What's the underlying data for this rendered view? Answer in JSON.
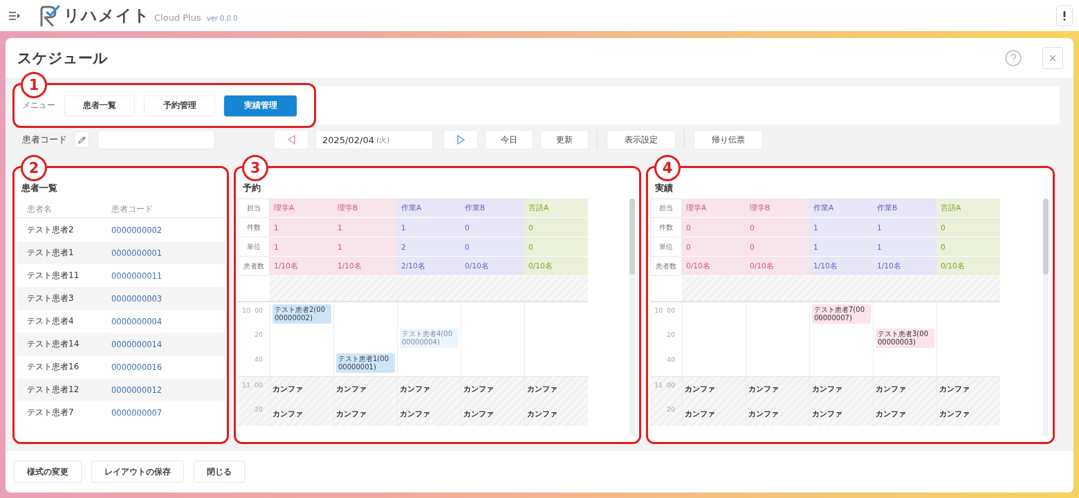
{
  "app_bar": {
    "product": "リハメイト",
    "edition": "Cloud Plus",
    "version": "ver 0.0.0"
  },
  "dialog": {
    "title": "スケジュール"
  },
  "menu": {
    "annotation": "1",
    "label": "メニュー",
    "items": [
      {
        "label": "患者一覧",
        "selected": false
      },
      {
        "label": "予約管理",
        "selected": false
      },
      {
        "label": "実績管理",
        "selected": true
      }
    ]
  },
  "toolbar": {
    "patient_code_label": "患者コード",
    "date": {
      "value": "2025/02/04",
      "weekday": "(火)"
    },
    "button_groups": [
      [
        "今日",
        "更新"
      ],
      [
        "表示設定"
      ],
      [
        "帰り伝票"
      ]
    ]
  },
  "patients": {
    "annotation": "2",
    "title": "患者一覧",
    "columns": [
      "患者名",
      "患者コード"
    ],
    "rows": [
      {
        "name": "テスト患者2",
        "code": "0000000002"
      },
      {
        "name": "テスト患者1",
        "code": "0000000001"
      },
      {
        "name": "テスト患者11",
        "code": "0000000011"
      },
      {
        "name": "テスト患者3",
        "code": "0000000003"
      },
      {
        "name": "テスト患者4",
        "code": "0000000004"
      },
      {
        "name": "テスト患者14",
        "code": "0000000014"
      },
      {
        "name": "テスト患者16",
        "code": "0000000016"
      },
      {
        "name": "テスト患者12",
        "code": "0000000012"
      },
      {
        "name": "テスト患者7",
        "code": "0000000007"
      }
    ]
  },
  "reservations": {
    "annotation": "3",
    "title": "予約",
    "staff_label": "担当",
    "staff": [
      {
        "name": "理学A",
        "color": "#d4557f"
      },
      {
        "name": "理学B",
        "color": "#d4557f"
      },
      {
        "name": "作業A",
        "color": "#6a62c4"
      },
      {
        "name": "作業B",
        "color": "#6a62c4"
      },
      {
        "name": "言語A",
        "color": "#7fa41c"
      }
    ],
    "summary_rows": [
      {
        "label": "件数",
        "values": [
          "1",
          "1",
          "1",
          "0",
          "0"
        ]
      },
      {
        "label": "単位",
        "values": [
          "1",
          "1",
          "2",
          "0",
          "0"
        ]
      },
      {
        "label": "患者数",
        "values": [
          "1/10名",
          "1/10名",
          "2/10名",
          "0/10名",
          "0/10名"
        ]
      }
    ],
    "time_blocks": [
      {
        "hour": "10",
        "slots": [
          {
            "minute": "00",
            "kind": "open",
            "cells": [
              {
                "kind": "reserved",
                "text": "テスト患者2(0000000002)"
              },
              {
                "kind": "free"
              },
              {
                "kind": "free"
              },
              {
                "kind": "free"
              },
              {
                "kind": "free"
              }
            ]
          },
          {
            "minute": "20",
            "kind": "open",
            "cells": [
              {
                "kind": "free"
              },
              {
                "kind": "free"
              },
              {
                "kind": "tentative",
                "text": "テスト患者4(0000000004)"
              },
              {
                "kind": "free"
              },
              {
                "kind": "free"
              }
            ]
          },
          {
            "minute": "40",
            "kind": "open",
            "cells": [
              {
                "kind": "free"
              },
              {
                "kind": "reserved",
                "text": "テスト患者1(0000000001)"
              },
              {
                "kind": "free"
              },
              {
                "kind": "free"
              },
              {
                "kind": "free"
              }
            ]
          }
        ]
      },
      {
        "hour": "11",
        "slots": [
          {
            "minute": "00",
            "kind": "closed",
            "cells": [
              {
                "kind": "note",
                "text": "カンファ"
              },
              {
                "kind": "note",
                "text": "カンファ"
              },
              {
                "kind": "note",
                "text": "カンファ"
              },
              {
                "kind": "note",
                "text": "カンファ"
              },
              {
                "kind": "note",
                "text": "カンファ"
              }
            ]
          },
          {
            "minute": "20",
            "kind": "closed",
            "cells": [
              {
                "kind": "note",
                "text": "カンファ"
              },
              {
                "kind": "note",
                "text": "カンファ"
              },
              {
                "kind": "note",
                "text": "カンファ"
              },
              {
                "kind": "note",
                "text": "カンファ"
              },
              {
                "kind": "note",
                "text": "カンファ"
              }
            ]
          }
        ]
      }
    ]
  },
  "results": {
    "annotation": "4",
    "title": "実績",
    "staff_label": "担当",
    "staff": [
      {
        "name": "理学A",
        "color": "#d4557f"
      },
      {
        "name": "理学B",
        "color": "#d4557f"
      },
      {
        "name": "作業A",
        "color": "#6a62c4"
      },
      {
        "name": "作業B",
        "color": "#6a62c4"
      },
      {
        "name": "言語A",
        "color": "#7fa41c"
      }
    ],
    "summary_rows": [
      {
        "label": "件数",
        "values": [
          "0",
          "0",
          "1",
          "1",
          "0"
        ]
      },
      {
        "label": "単位",
        "values": [
          "0",
          "0",
          "1",
          "1",
          "0"
        ]
      },
      {
        "label": "患者数",
        "values": [
          "0/10名",
          "0/10名",
          "1/10名",
          "1/10名",
          "0/10名"
        ]
      }
    ],
    "time_blocks": [
      {
        "hour": "10",
        "slots": [
          {
            "minute": "00",
            "kind": "open",
            "cells": [
              {
                "kind": "free"
              },
              {
                "kind": "free"
              },
              {
                "kind": "actual",
                "text": "テスト患者7(0000000007)"
              },
              {
                "kind": "free"
              },
              {
                "kind": "free"
              }
            ]
          },
          {
            "minute": "20",
            "kind": "open",
            "cells": [
              {
                "kind": "free"
              },
              {
                "kind": "free"
              },
              {
                "kind": "free"
              },
              {
                "kind": "actual",
                "text": "テスト患者3(0000000003)"
              },
              {
                "kind": "free"
              }
            ]
          },
          {
            "minute": "40",
            "kind": "open",
            "cells": [
              {
                "kind": "free"
              },
              {
                "kind": "free"
              },
              {
                "kind": "free"
              },
              {
                "kind": "free"
              },
              {
                "kind": "free"
              }
            ]
          }
        ]
      },
      {
        "hour": "11",
        "slots": [
          {
            "minute": "00",
            "kind": "closed",
            "cells": [
              {
                "kind": "note",
                "text": "カンファ"
              },
              {
                "kind": "note",
                "text": "カンファ"
              },
              {
                "kind": "note",
                "text": "カンファ"
              },
              {
                "kind": "note",
                "text": "カンファ"
              },
              {
                "kind": "note",
                "text": "カンファ"
              }
            ]
          },
          {
            "minute": "20",
            "kind": "closed",
            "cells": [
              {
                "kind": "note",
                "text": "カンファ"
              },
              {
                "kind": "note",
                "text": "カンファ"
              },
              {
                "kind": "note",
                "text": "カンファ"
              },
              {
                "kind": "note",
                "text": "カンファ"
              },
              {
                "kind": "note",
                "text": "カンファ"
              }
            ]
          }
        ]
      }
    ]
  },
  "footer": {
    "buttons": [
      "様式の変更",
      "レイアウトの保存",
      "閉じる"
    ]
  }
}
